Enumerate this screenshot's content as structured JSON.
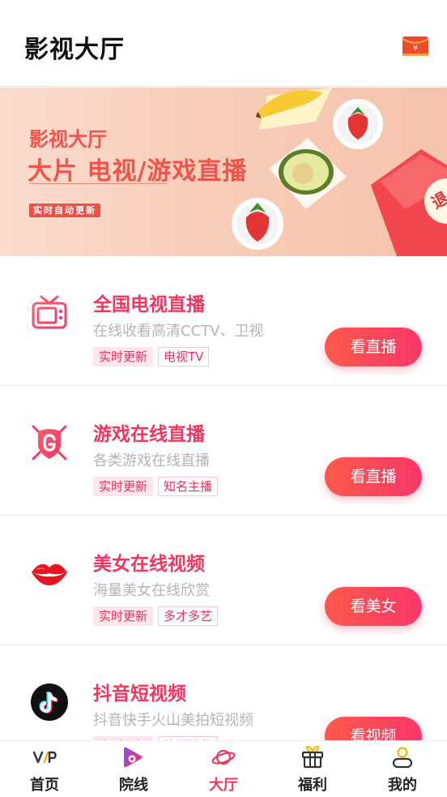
{
  "header": {
    "title": "影视大厅",
    "wallet_icon": "red-envelope-icon",
    "wallet_symbol": "¥"
  },
  "banner": {
    "line1": "影视大厅",
    "line2": "大片 电视/游戏直播",
    "tag": "实时自动更新",
    "corner_char": "退"
  },
  "items": [
    {
      "icon": "tv-icon",
      "title": "全国电视直播",
      "desc": "在线收看高清CCTV、卫视",
      "tags": [
        "实时更新",
        "电视TV"
      ],
      "button": "看直播"
    },
    {
      "icon": "game-shield-icon",
      "title": "游戏在线直播",
      "desc": "各类游戏在线直播",
      "tags": [
        "实时更新",
        "知名主播"
      ],
      "button": "看直播"
    },
    {
      "icon": "lips-icon",
      "title": "美女在线视频",
      "desc": "海量美女在线欣赏",
      "tags": [
        "实时更新",
        "多才多艺"
      ],
      "button": "看美女"
    },
    {
      "icon": "tiktok-icon",
      "title": "抖音短视频",
      "desc": "抖音快手火山美拍短视频",
      "tags": [
        "实时更新",
        "热门推荐"
      ],
      "button": "看视频"
    }
  ],
  "tabbar": {
    "tabs": [
      {
        "label": "首页",
        "icon": "vip-icon"
      },
      {
        "label": "院线",
        "icon": "play-film-icon"
      },
      {
        "label": "大厅",
        "icon": "planet-icon"
      },
      {
        "label": "福利",
        "icon": "gift-icon"
      },
      {
        "label": "我的",
        "icon": "user-icon"
      }
    ],
    "active_index": 2
  },
  "colors": {
    "accent": "#f2365f",
    "button_start": "#fc5a4a",
    "button_end": "#f9376a",
    "banner_text": "#f0544b"
  }
}
